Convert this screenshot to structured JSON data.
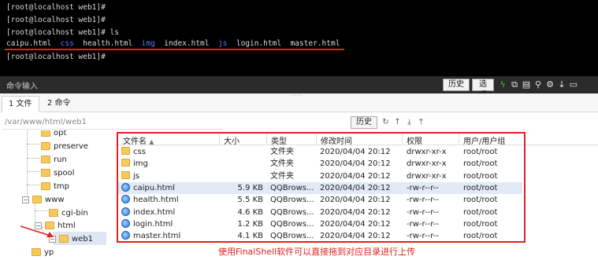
{
  "terminal": {
    "lines": [
      "[root@localhost web1]#",
      "[root@localhost web1]#",
      "[root@localhost web1]# ls"
    ],
    "ls_output": {
      "items": [
        {
          "text": "caipu.html",
          "kind": "file"
        },
        {
          "text": "css",
          "kind": "dir"
        },
        {
          "text": "health.html",
          "kind": "file"
        },
        {
          "text": "img",
          "kind": "dir"
        },
        {
          "text": "index.html",
          "kind": "file"
        },
        {
          "text": "js",
          "kind": "dir"
        },
        {
          "text": "login.html",
          "kind": "file"
        },
        {
          "text": "master.html",
          "kind": "file"
        }
      ]
    },
    "last_line": "[root@localhost web1]#",
    "colors": {
      "background": "#000000",
      "text": "#d8d8d8",
      "dir": "#4b7bff",
      "highlight": "#e02020"
    }
  },
  "cmdbar": {
    "label": "命令输入",
    "history_button": "历史",
    "options_button": "选项",
    "tools": [
      {
        "icon": "lightning-icon",
        "glyph": "ϟ",
        "color": "#33cc33"
      },
      {
        "icon": "copy-icon",
        "glyph": "⧉",
        "color": "#e8e8e8"
      },
      {
        "icon": "paste-icon",
        "glyph": "▤",
        "color": "#e8e8e8"
      },
      {
        "icon": "search-icon",
        "glyph": "⚲",
        "color": "#e8e8e8"
      },
      {
        "icon": "gear-icon",
        "glyph": "⚙",
        "color": "#e8e8e8"
      },
      {
        "icon": "download-icon",
        "glyph": "↓",
        "color": "#e8e8e8"
      },
      {
        "icon": "window-icon",
        "glyph": "▭",
        "color": "#e8e8e8"
      }
    ]
  },
  "tabs": [
    {
      "label": "1 文件",
      "active": true
    },
    {
      "label": "2 命令",
      "active": false
    }
  ],
  "pathbar": {
    "path": "/var/www/html/web1",
    "history_button": "历史",
    "tools": [
      {
        "icon": "refresh-icon",
        "glyph": "↻"
      },
      {
        "icon": "up-dir-icon",
        "glyph": "↑"
      },
      {
        "icon": "download-icon",
        "glyph": "⤓"
      },
      {
        "icon": "upload-icon",
        "glyph": "⤒"
      }
    ]
  },
  "tree": [
    {
      "label": "opt"
    },
    {
      "label": "preserve"
    },
    {
      "label": "run"
    },
    {
      "label": "spool"
    },
    {
      "label": "tmp"
    },
    {
      "label": "www",
      "toggle": "−"
    },
    {
      "label": "cgi-bin"
    },
    {
      "label": "html",
      "toggle": "−"
    },
    {
      "label": "web1",
      "toggle": "−",
      "selected": true
    },
    {
      "label": "yp"
    }
  ],
  "file_table": {
    "columns": [
      "文件名",
      "大小",
      "类型",
      "修改时间",
      "权限",
      "用户/用户组"
    ],
    "sort_indicator": "▲",
    "rows": [
      {
        "name": "css",
        "size": "",
        "type": "文件夹",
        "mtime": "2020/04/04 20:12",
        "perm": "drwxr-xr-x",
        "owner": "root/root",
        "kind": "folder"
      },
      {
        "name": "img",
        "size": "",
        "type": "文件夹",
        "mtime": "2020/04/04 20:12",
        "perm": "drwxr-xr-x",
        "owner": "root/root",
        "kind": "folder"
      },
      {
        "name": "js",
        "size": "",
        "type": "文件夹",
        "mtime": "2020/04/04 20:12",
        "perm": "drwxr-xr-x",
        "owner": "root/root",
        "kind": "folder"
      },
      {
        "name": "caipu.html",
        "size": "5.9 KB",
        "type": "QQBrows...",
        "mtime": "2020/04/04 20:12",
        "perm": "-rw-r--r--",
        "owner": "root/root",
        "kind": "html",
        "highlighted": true
      },
      {
        "name": "health.html",
        "size": "5.5 KB",
        "type": "QQBrows...",
        "mtime": "2020/04/04 20:12",
        "perm": "-rw-r--r--",
        "owner": "root/root",
        "kind": "html"
      },
      {
        "name": "index.html",
        "size": "4.6 KB",
        "type": "QQBrows...",
        "mtime": "2020/04/04 20:12",
        "perm": "-rw-r--r--",
        "owner": "root/root",
        "kind": "html"
      },
      {
        "name": "login.html",
        "size": "1.2 KB",
        "type": "QQBrows...",
        "mtime": "2020/04/04 20:12",
        "perm": "-rw-r--r--",
        "owner": "root/root",
        "kind": "html"
      },
      {
        "name": "master.html",
        "size": "4.1 KB",
        "type": "QQBrows...",
        "mtime": "2020/04/04 20:12",
        "perm": "-rw-r--r--",
        "owner": "root/root",
        "kind": "html"
      }
    ]
  },
  "annotation": {
    "caption": "使用FinalShell软件可以直接拖到对应目录进行上传",
    "color": "#e02020"
  }
}
